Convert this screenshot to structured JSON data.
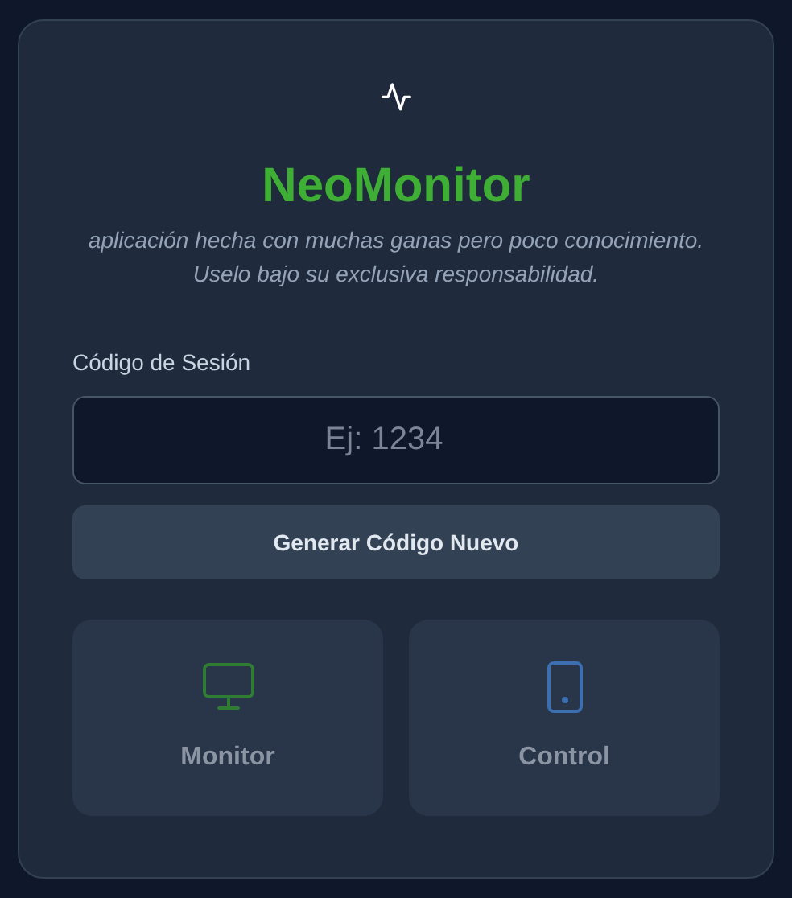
{
  "app": {
    "title": "NeoMonitor",
    "subtitle": "aplicación hecha con muchas ganas pero poco conocimiento. Uselo bajo su exclusiva responsabilidad."
  },
  "session_code": {
    "label": "Código de Sesión",
    "placeholder": "Ej: 1234"
  },
  "generate_button": {
    "label": "Generar Código Nuevo"
  },
  "modes": [
    {
      "kind": "monitor",
      "label": "Monitor",
      "disabled": true
    },
    {
      "kind": "control",
      "label": "Control",
      "disabled": true
    }
  ]
}
